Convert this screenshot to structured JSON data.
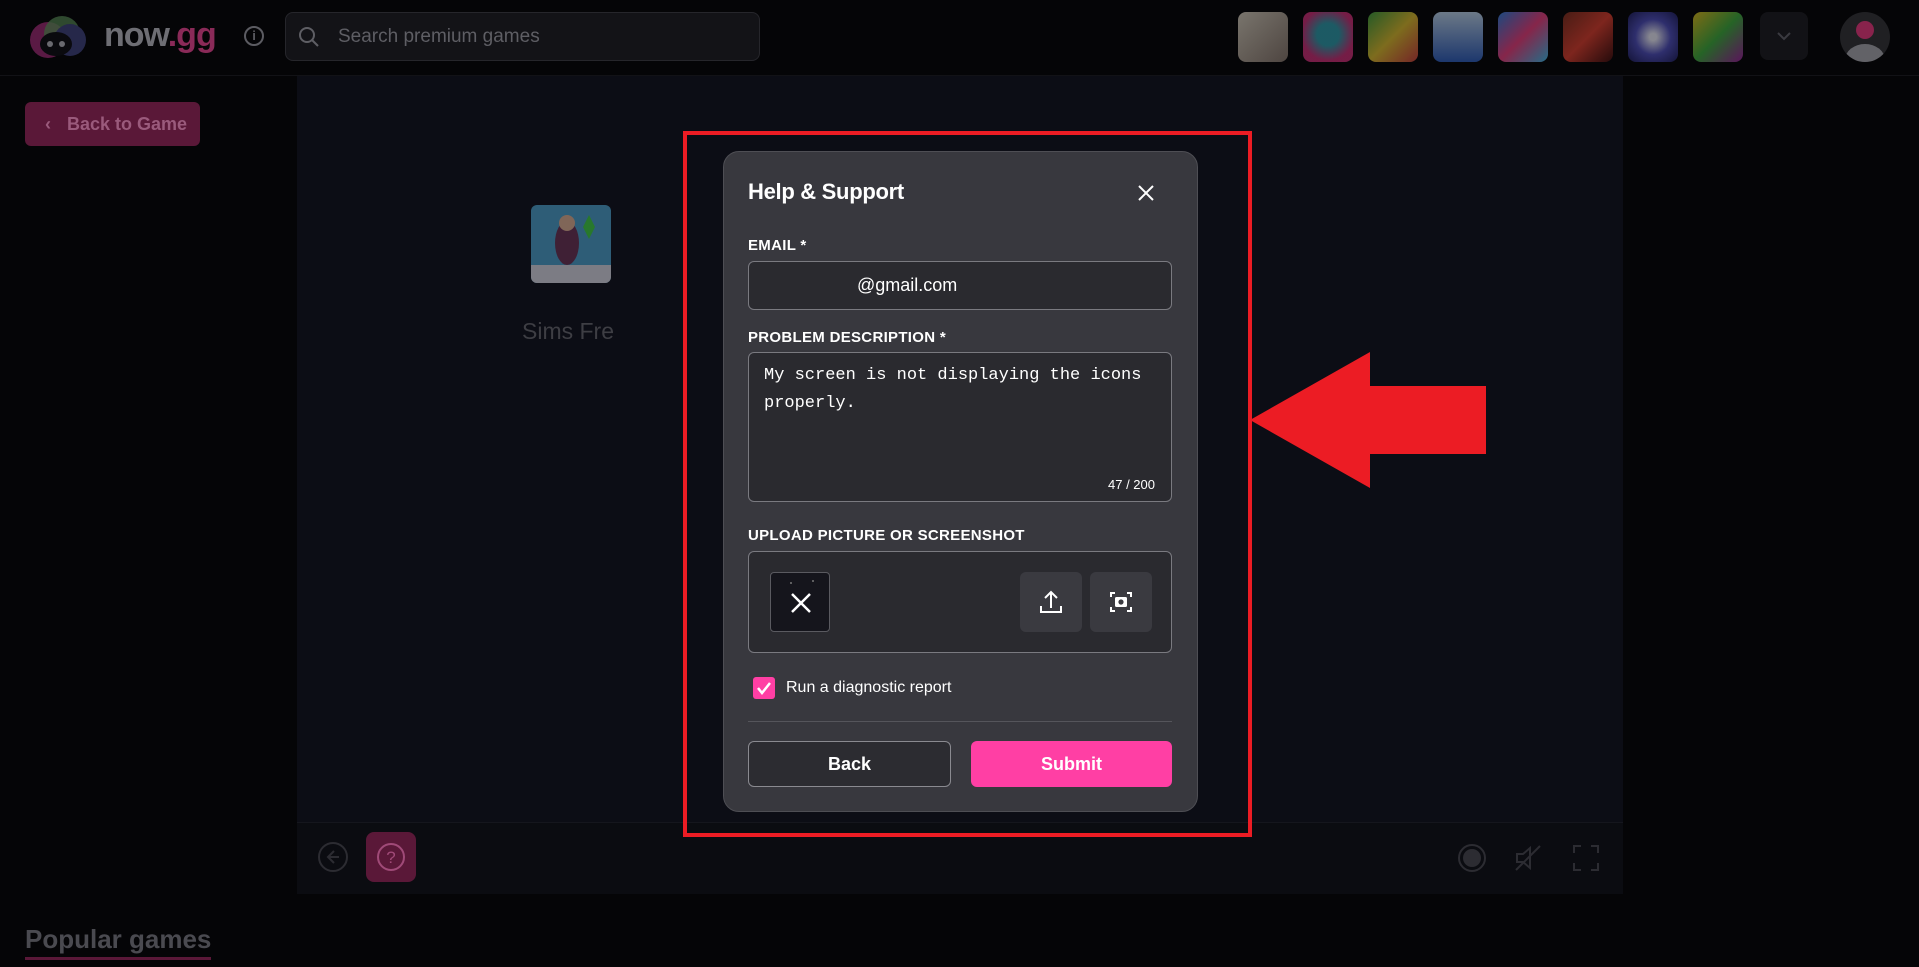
{
  "header": {
    "brand_main": "now",
    "brand_accent": ".gg",
    "search_placeholder": "Search premium games",
    "game_icons": [
      "game-1",
      "game-2",
      "game-3",
      "game-4",
      "game-5",
      "game-6",
      "game-7",
      "game-8"
    ]
  },
  "page": {
    "back_to_game_label": "Back to Game",
    "game_title": "Sims Fre",
    "popular_games_heading": "Popular games"
  },
  "modal": {
    "title": "Help & Support",
    "email_label": "EMAIL *",
    "email_value": "@gmail.com",
    "description_label": "PROBLEM DESCRIPTION *",
    "description_value": "My screen is not displaying the icons properly.",
    "char_count": "47 / 200",
    "upload_label": "UPLOAD PICTURE OR SCREENSHOT",
    "diagnostic_label": "Run a diagnostic report",
    "diagnostic_checked": true,
    "back_label": "Back",
    "submit_label": "Submit"
  },
  "colors": {
    "accent": "#ff3fa4",
    "annotation_red": "#ec1c24",
    "modal_bg": "#38383e",
    "page_bg": "#050507"
  }
}
